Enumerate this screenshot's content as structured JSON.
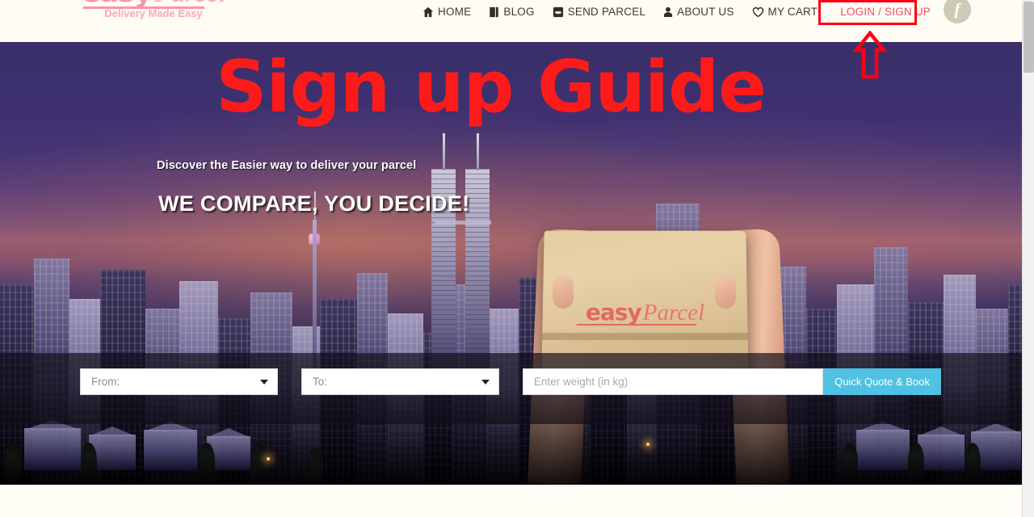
{
  "header": {
    "logo": {
      "word1": "easy",
      "word2": "Parcel",
      "tagline": "Delivery Made Easy"
    },
    "nav": [
      {
        "label": "HOME",
        "icon": "home-icon"
      },
      {
        "label": "BLOG",
        "icon": "book-icon"
      },
      {
        "label": "SEND PARCEL",
        "icon": "inbox-icon"
      },
      {
        "label": "ABOUT US",
        "icon": "user-icon"
      },
      {
        "label": "MY CART",
        "icon": "heart-icon"
      }
    ],
    "login_label": "LOGIN / SIGN UP",
    "social": {
      "facebook_glyph": "f"
    }
  },
  "hero": {
    "title": "Sign up Guide",
    "subtitle": "Discover the Easier way to deliver your parcel",
    "slogan": "WE COMPARE, YOU DECIDE!",
    "box_logo": {
      "word1": "easy",
      "word2": "Parcel"
    }
  },
  "quote_form": {
    "from_label": "From:",
    "to_label": "To:",
    "weight_value": "",
    "weight_placeholder": "Enter weight (in kg)",
    "submit_label": "Quick Quote & Book"
  },
  "annotations": {
    "highlight_target": "LOGIN / SIGN UP",
    "box_color": "#fb0014",
    "arrow_color": "#fb0014"
  },
  "colors": {
    "header_bg": "#fffdf3",
    "login_pink": "#f5476d",
    "title_red": "#fc1b1b",
    "button_blue": "#4fc1e3",
    "logo_pink": "#f993b0"
  }
}
